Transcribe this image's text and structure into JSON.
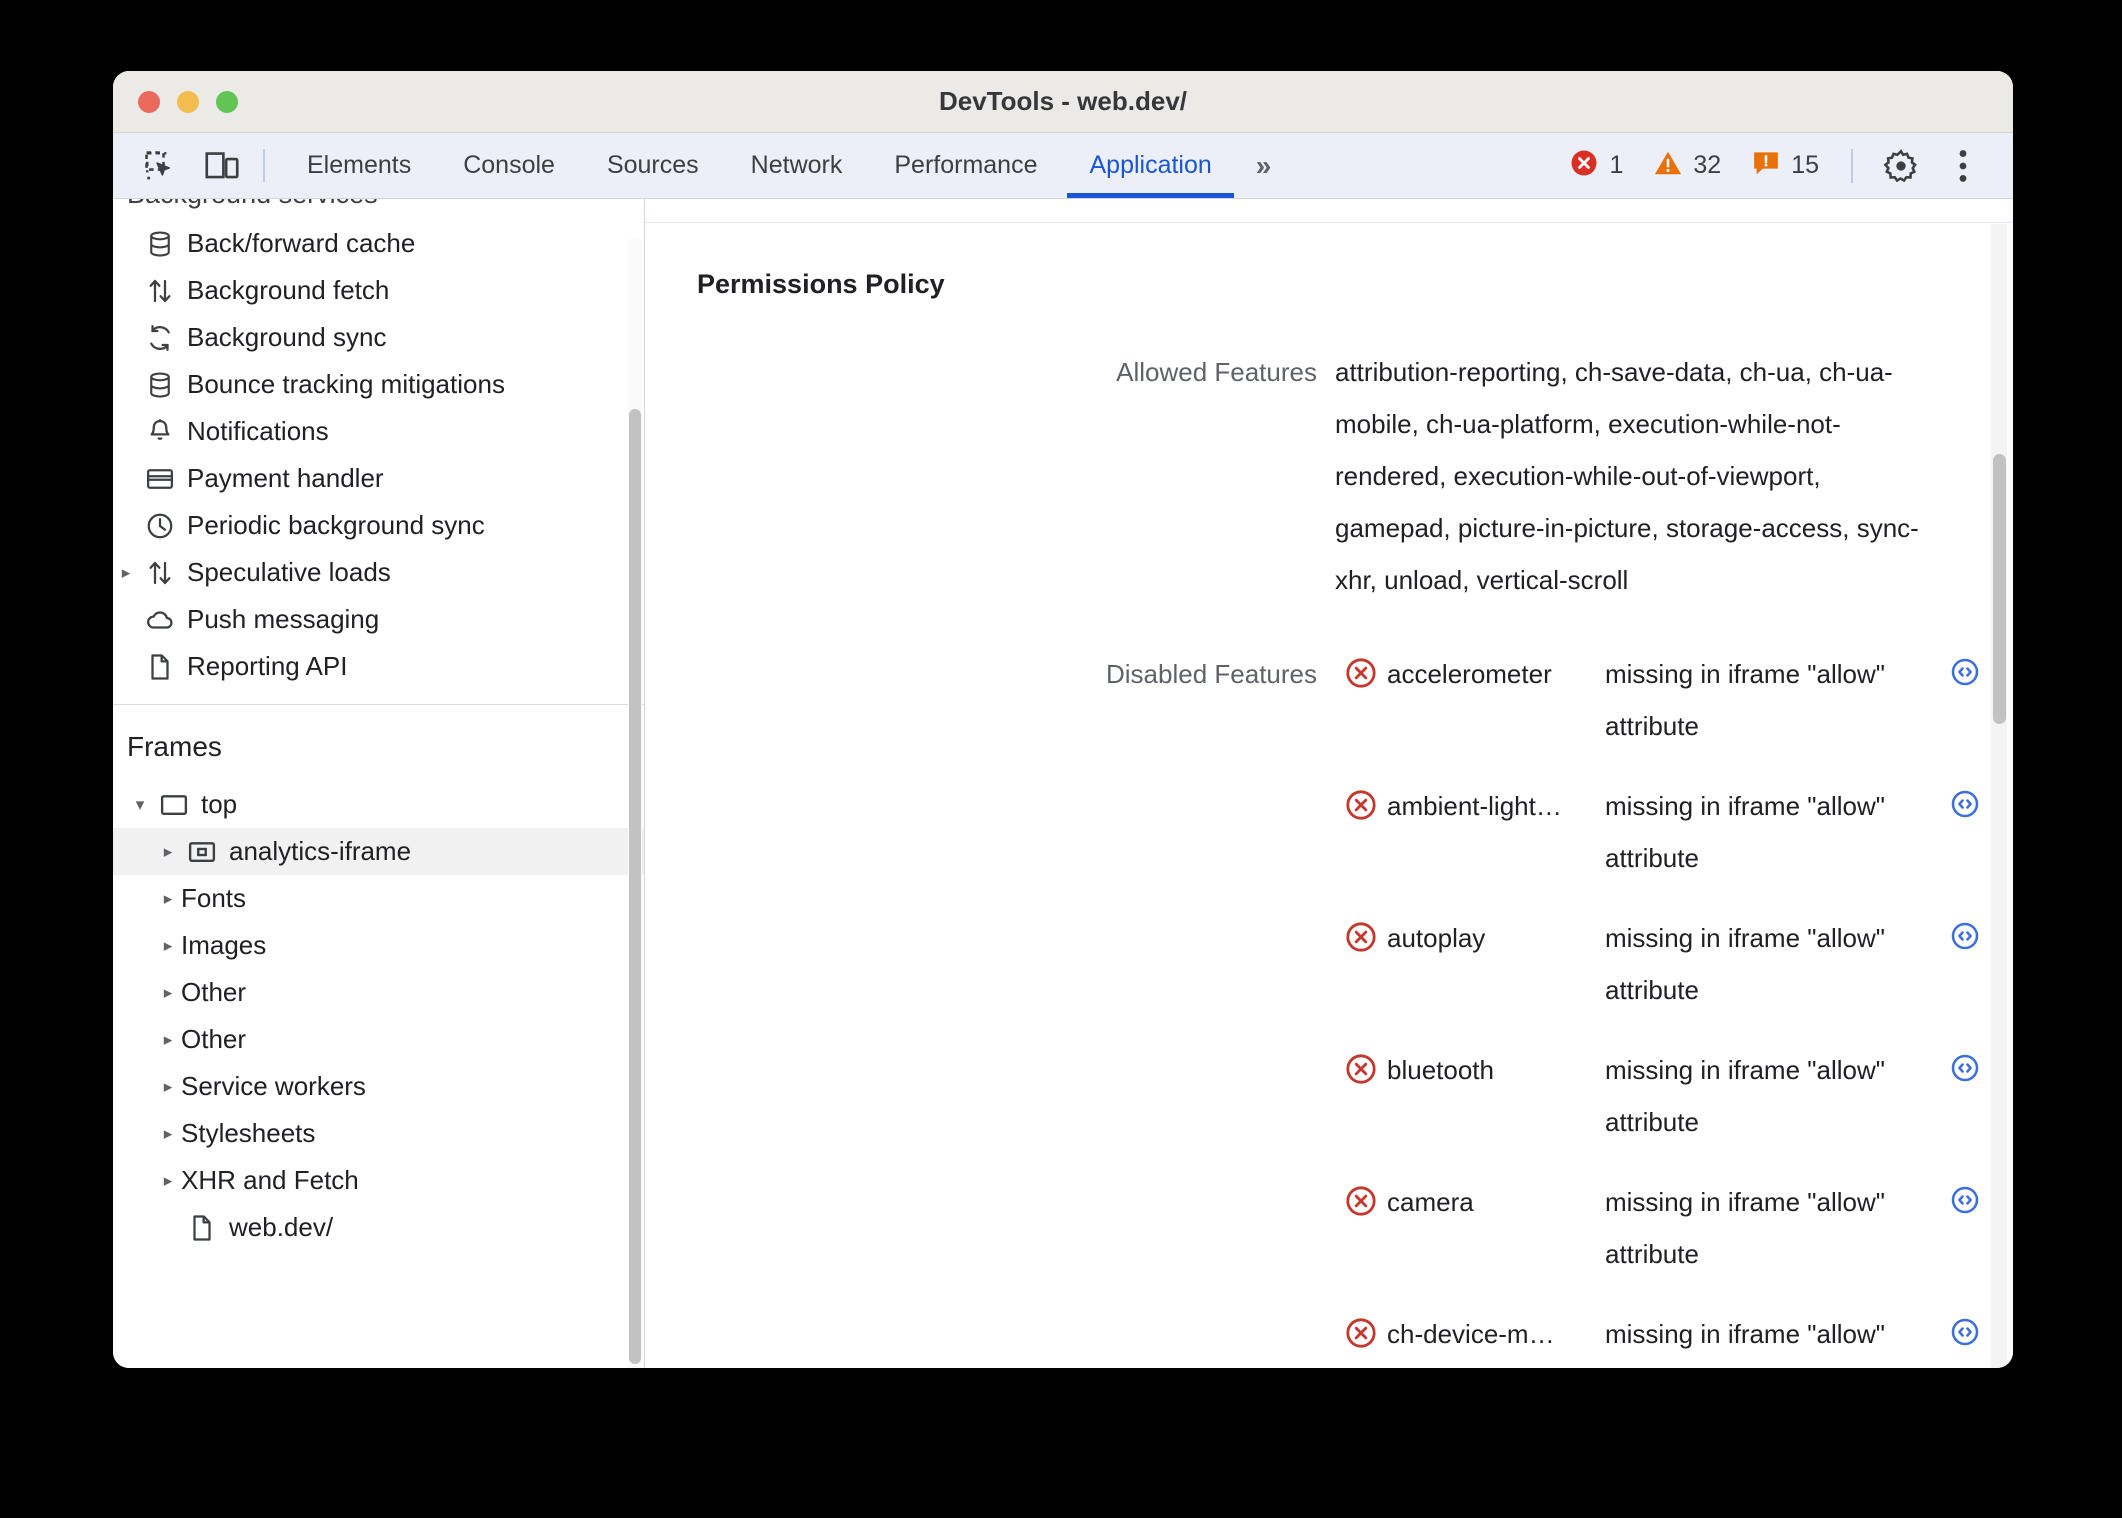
{
  "window": {
    "title": "DevTools - web.dev/",
    "traffic_lights": [
      "close-button",
      "minimize-button",
      "maximize-button"
    ]
  },
  "toolbar": {
    "inspect_icon": "inspect-element-icon",
    "device_icon": "device-toolbar-icon",
    "tabs": [
      {
        "label": "Elements",
        "active": false
      },
      {
        "label": "Console",
        "active": false
      },
      {
        "label": "Sources",
        "active": false
      },
      {
        "label": "Network",
        "active": false
      },
      {
        "label": "Performance",
        "active": false
      },
      {
        "label": "Application",
        "active": true
      }
    ],
    "more_tabs_label": "»",
    "counters": {
      "errors": "1",
      "warnings": "32",
      "infos": "15"
    },
    "settings_icon": "gear-icon",
    "more_icon": "kebab-menu-icon",
    "colors": {
      "active_tab": "#1a55d4",
      "error": "#d93025",
      "warning": "#e8710a",
      "info": "#e8710a"
    }
  },
  "sidebar": {
    "background_services": {
      "title": "Background services",
      "items": [
        {
          "label": "Back/forward cache",
          "icon": "database-icon",
          "expandable": false
        },
        {
          "label": "Background fetch",
          "icon": "arrows-up-down-icon",
          "expandable": false
        },
        {
          "label": "Background sync",
          "icon": "sync-icon",
          "expandable": false
        },
        {
          "label": "Bounce tracking mitigations",
          "icon": "database-icon",
          "expandable": false
        },
        {
          "label": "Notifications",
          "icon": "bell-icon",
          "expandable": false
        },
        {
          "label": "Payment handler",
          "icon": "credit-card-icon",
          "expandable": false
        },
        {
          "label": "Periodic background sync",
          "icon": "clock-icon",
          "expandable": false
        },
        {
          "label": "Speculative loads",
          "icon": "arrows-up-down-icon",
          "expandable": true
        },
        {
          "label": "Push messaging",
          "icon": "cloud-icon",
          "expandable": false
        },
        {
          "label": "Reporting API",
          "icon": "document-icon",
          "expandable": false
        }
      ]
    },
    "frames": {
      "title": "Frames",
      "items": [
        {
          "label": "top",
          "icon": "frame-icon",
          "expandable": true,
          "expanded": true,
          "depth": 0,
          "selected": false
        },
        {
          "label": "analytics-iframe",
          "icon": "iframe-icon",
          "expandable": true,
          "expanded": false,
          "depth": 1,
          "selected": true
        },
        {
          "label": "Fonts",
          "icon": "",
          "expandable": true,
          "expanded": false,
          "depth": 1,
          "selected": false
        },
        {
          "label": "Images",
          "icon": "",
          "expandable": true,
          "expanded": false,
          "depth": 1,
          "selected": false
        },
        {
          "label": "Other",
          "icon": "",
          "expandable": true,
          "expanded": false,
          "depth": 1,
          "selected": false
        },
        {
          "label": "Other",
          "icon": "",
          "expandable": true,
          "expanded": false,
          "depth": 1,
          "selected": false
        },
        {
          "label": "Service workers",
          "icon": "",
          "expandable": true,
          "expanded": false,
          "depth": 1,
          "selected": false
        },
        {
          "label": "Stylesheets",
          "icon": "",
          "expandable": true,
          "expanded": false,
          "depth": 1,
          "selected": false
        },
        {
          "label": "XHR and Fetch",
          "icon": "",
          "expandable": true,
          "expanded": false,
          "depth": 1,
          "selected": false
        },
        {
          "label": "web.dev/",
          "icon": "document-icon",
          "expandable": false,
          "expanded": false,
          "depth": 1,
          "selected": false
        }
      ]
    }
  },
  "main": {
    "section_title": "Permissions Policy",
    "allowed": {
      "label": "Allowed Features",
      "value": "attribution-reporting, ch-save-data, ch-ua, ch-ua-mobile, ch-ua-platform, execution-while-not-rendered, execution-while-out-of-viewport, gamepad, picture-in-picture, storage-access, sync-xhr, unload, vertical-scroll"
    },
    "disabled": {
      "label": "Disabled Features",
      "reveal_icon": "code-reveal-icon",
      "status_icon": "error-circle-x-icon",
      "rows": [
        {
          "name": "accelerometer",
          "reason": "missing in iframe \"allow\" attribute"
        },
        {
          "name": "ambient-light…",
          "reason": "missing in iframe \"allow\" attribute"
        },
        {
          "name": "autoplay",
          "reason": "missing in iframe \"allow\" attribute"
        },
        {
          "name": "bluetooth",
          "reason": "missing in iframe \"allow\" attribute"
        },
        {
          "name": "camera",
          "reason": "missing in iframe \"allow\" attribute"
        },
        {
          "name": "ch-device-m…",
          "reason": "missing in iframe \"allow\" attribute"
        }
      ]
    }
  }
}
